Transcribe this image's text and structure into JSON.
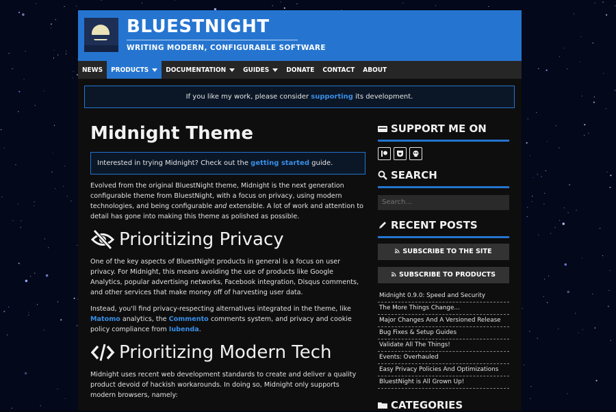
{
  "site": {
    "title": "BLUESTNIGHT",
    "tagline": "WRITING MODERN, CONFIGURABLE SOFTWARE"
  },
  "nav": [
    {
      "label": "NEWS",
      "dropdown": false,
      "active": false
    },
    {
      "label": "PRODUCTS",
      "dropdown": true,
      "active": true
    },
    {
      "label": "DOCUMENTATION",
      "dropdown": true,
      "active": false
    },
    {
      "label": "GUIDES",
      "dropdown": true,
      "active": false
    },
    {
      "label": "DONATE",
      "dropdown": false,
      "active": false
    },
    {
      "label": "CONTACT",
      "dropdown": false,
      "active": false
    },
    {
      "label": "ABOUT",
      "dropdown": false,
      "active": false
    }
  ],
  "notice": {
    "before": "If you like my work, please consider ",
    "link": "supporting",
    "after": " its development."
  },
  "main": {
    "title": "Midnight Theme",
    "callout": {
      "before": "Interested in trying Midnight? Check out the ",
      "link": "getting started",
      "after": " guide."
    },
    "intro": {
      "before": "Evolved from the original BluestNight theme, Midnight is the next generation configurable theme from BluestNight, with a focus on privacy, using modern technologies, and being configurable ",
      "em": "and",
      "after": " extensible. A lot of work and attention to detail has gone into making this theme as polished as possible."
    },
    "privacy": {
      "heading": "Prioritizing Privacy",
      "icon": "eye-slash-icon",
      "p1": "One of the key aspects of BluestNight products in general is a focus on user privacy. For Midnight, this means avoiding the use of products like Google Analytics, popular advertising networks, Facebook integration, Disqus comments, and other services that make money off of harvesting user data.",
      "p2_a": "Instead, you'll find privacy-respecting alternatives integrated in the theme, like ",
      "p2_link1": "Matomo",
      "p2_b": " analytics, the ",
      "p2_link2": "Commento",
      "p2_c": " comments system, and privacy and cookie policy compliance from ",
      "p2_link3": "Iubenda",
      "p2_d": "."
    },
    "modern": {
      "heading": "Prioritizing Modern Tech",
      "icon": "code-icon",
      "p1": "Midnight uses recent web development standards to create and deliver a quality product devoid of hackish workarounds. In doing so, Midnight only supports modern browsers, namely:"
    }
  },
  "sidebar": {
    "support": {
      "heading": "SUPPORT ME ON",
      "icons": [
        "patreon-icon",
        "liberapay-icon",
        "kofi-icon"
      ]
    },
    "search": {
      "heading": "SEARCH",
      "placeholder": "Search..."
    },
    "recent": {
      "heading": "RECENT POSTS",
      "subscribe_site": "SUBSCRIBE TO THE SITE",
      "subscribe_products": "SUBSCRIBE TO PRODUCTS",
      "posts": [
        "Midnight 0.9.0: Speed and Security",
        "The More Things Change...",
        "Major Changes And A Versioned Release",
        "Bug Fixes & Setup Guides",
        "Validate All The Things!",
        "Events: Overhauled",
        "Easy Privacy Policies And Optimizations",
        "BluestNight is All Grown Up!"
      ]
    },
    "categories": {
      "heading": "CATEGORIES"
    }
  },
  "colors": {
    "accent": "#2575d0",
    "link": "#3a8ee6",
    "background": "#0e0e0e",
    "nav": "#262626"
  }
}
